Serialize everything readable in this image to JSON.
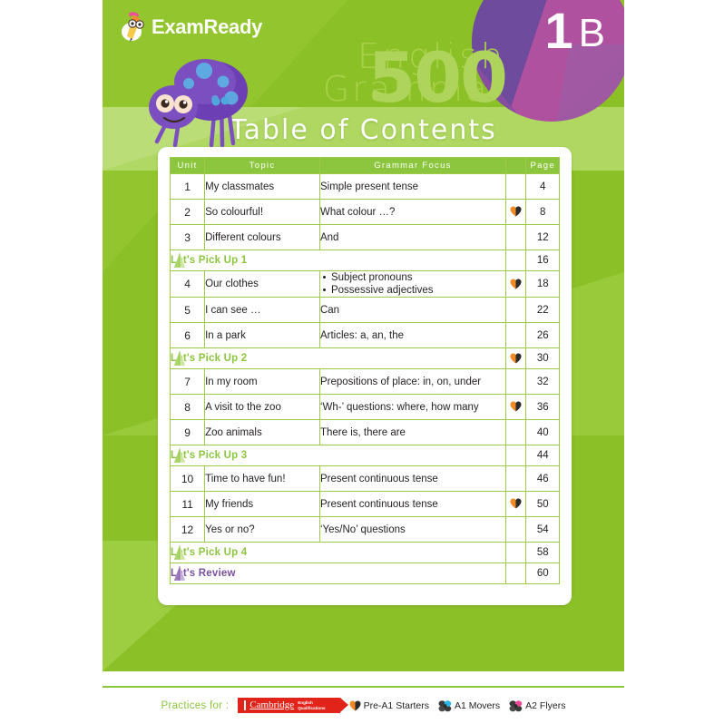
{
  "brand": {
    "logo_text": "ExamReady",
    "logo_icon": "pencil-mascot-icon"
  },
  "cover": {
    "watermark_line1": "English",
    "watermark_line2": "Grammar",
    "watermark_number": "500",
    "level_number": "1",
    "level_letter": "B",
    "page_title": "Table of Contents",
    "mascot_icon": "purple-spider-icon"
  },
  "table": {
    "headers": {
      "unit": "Unit",
      "topic": "Topic",
      "focus": "Grammar Focus",
      "icon": "",
      "page": "Page"
    },
    "rows": [
      {
        "kind": "unit",
        "unit": "1",
        "topic": "My classmates",
        "focus": "Simple present tense",
        "icon": false,
        "page": "4"
      },
      {
        "kind": "unit",
        "unit": "2",
        "topic": "So colourful!",
        "focus": "What colour …?",
        "icon": true,
        "page": "8"
      },
      {
        "kind": "unit",
        "unit": "3",
        "topic": "Different colours",
        "focus": "And",
        "icon": false,
        "page": "12"
      },
      {
        "kind": "pick",
        "label": "Let's Pick Up 1",
        "icon": false,
        "page": "16"
      },
      {
        "kind": "unit",
        "unit": "4",
        "topic": "Our clothes",
        "focus_list": [
          "Subject pronouns",
          "Possessive adjectives"
        ],
        "icon": true,
        "page": "18"
      },
      {
        "kind": "unit",
        "unit": "5",
        "topic": "I can see …",
        "focus": "Can",
        "icon": false,
        "page": "22"
      },
      {
        "kind": "unit",
        "unit": "6",
        "topic": "In a park",
        "focus": "Articles: a, an, the",
        "icon": false,
        "page": "26"
      },
      {
        "kind": "pick",
        "label": "Let's Pick Up 2",
        "icon": true,
        "page": "30"
      },
      {
        "kind": "unit",
        "unit": "7",
        "topic": "In my room",
        "focus": "Prepositions of place: in, on, under",
        "icon": false,
        "page": "32"
      },
      {
        "kind": "unit",
        "unit": "8",
        "topic": "A visit to the zoo",
        "focus": "‘Wh-’ questions: where, how many",
        "icon": true,
        "page": "36"
      },
      {
        "kind": "unit",
        "unit": "9",
        "topic": "Zoo animals",
        "focus": "There is, there are",
        "icon": false,
        "page": "40"
      },
      {
        "kind": "pick",
        "label": "Let's Pick Up 3",
        "icon": false,
        "page": "44"
      },
      {
        "kind": "unit",
        "unit": "10",
        "topic": "Time to have fun!",
        "focus": "Present continuous tense",
        "icon": false,
        "page": "46"
      },
      {
        "kind": "unit",
        "unit": "11",
        "topic": "My friends",
        "focus": "Present continuous tense",
        "icon": true,
        "page": "50"
      },
      {
        "kind": "unit",
        "unit": "12",
        "topic": "Yes or no?",
        "focus": "‘Yes/No’ questions",
        "icon": false,
        "page": "54"
      },
      {
        "kind": "pick",
        "label": "Let's Pick Up 4",
        "icon": false,
        "page": "58"
      },
      {
        "kind": "review",
        "label": "Let's Review",
        "icon": false,
        "page": "60"
      }
    ]
  },
  "footer": {
    "practices_for": "Practices for :",
    "cambridge_name": "Cambridge",
    "cambridge_qual_line1": "English",
    "cambridge_qual_line2": "Qualifications",
    "levels": [
      {
        "label": "Pre-A1 Starters",
        "icon": "heart-icon",
        "accent": "#f08a24"
      },
      {
        "label": "A1 Movers",
        "icon": "flower-icon",
        "accent": "#29b6e8"
      },
      {
        "label": "A2 Flyers",
        "icon": "flower-icon",
        "accent": "#ec4899"
      }
    ]
  },
  "colors": {
    "green": "#8cc027",
    "green_header": "#8cc63e",
    "purple": "#7c4fa0",
    "red": "#e2231a",
    "orange": "#f08a24"
  }
}
